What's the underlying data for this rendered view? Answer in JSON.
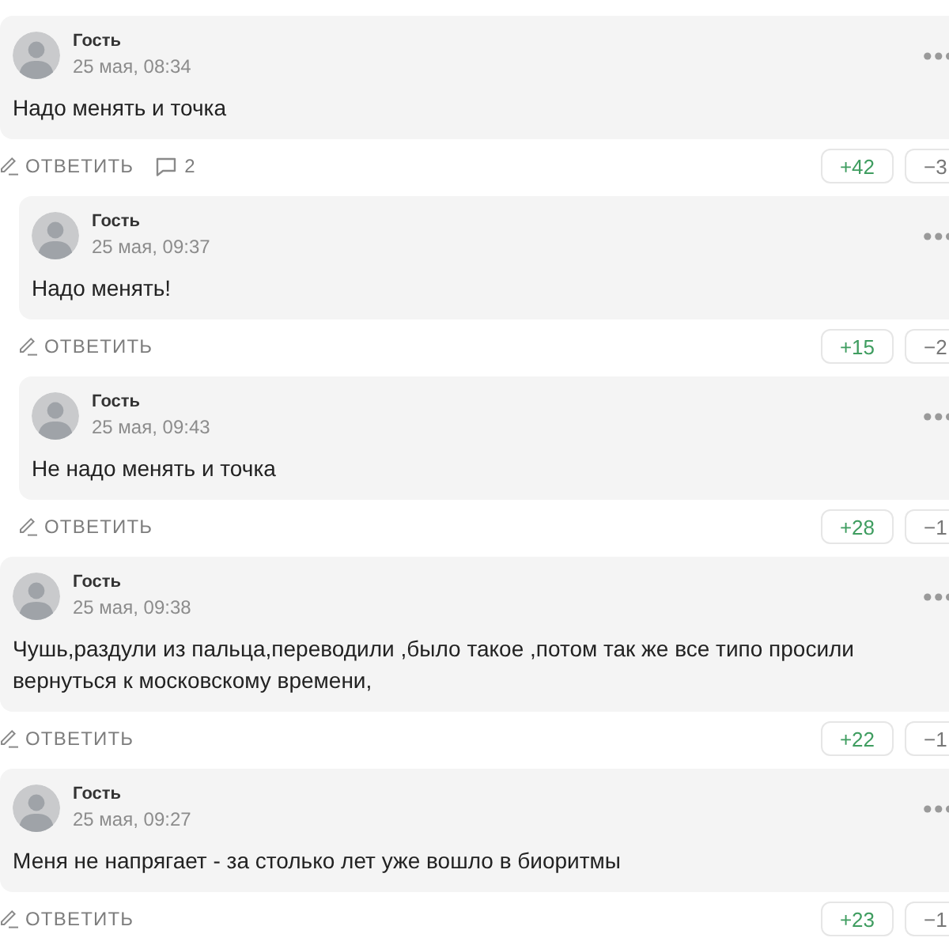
{
  "comments": [
    {
      "author": "Гость",
      "date": "25 мая, 08:34",
      "text": "Надо менять и точка",
      "reply_label": "ОТВЕТИТЬ",
      "reply_count": "2",
      "votes_up": "+42",
      "votes_down": "−3",
      "replies": [
        {
          "author": "Гость",
          "date": "25 мая, 09:37",
          "text": "Надо менять!",
          "reply_label": "ОТВЕТИТЬ",
          "votes_up": "+15",
          "votes_down": "−2"
        },
        {
          "author": "Гость",
          "date": "25 мая, 09:43",
          "text": "Не надо менять и точка",
          "reply_label": "ОТВЕТИТЬ",
          "votes_up": "+28",
          "votes_down": "−1"
        }
      ]
    },
    {
      "author": "Гость",
      "date": "25 мая, 09:38",
      "text": "Чушь,раздули из пальца,переводили ,было такое ,потом так же все типо просили вернуться к московскому времени,",
      "reply_label": "ОТВЕТИТЬ",
      "votes_up": "+22",
      "votes_down": "−1"
    },
    {
      "author": "Гость",
      "date": "25 мая, 09:27",
      "text": "Меня не напрягает - за столько лет уже вошло в биоритмы",
      "reply_label": "ОТВЕТИТЬ",
      "votes_up": "+23",
      "votes_down": "−1"
    }
  ]
}
